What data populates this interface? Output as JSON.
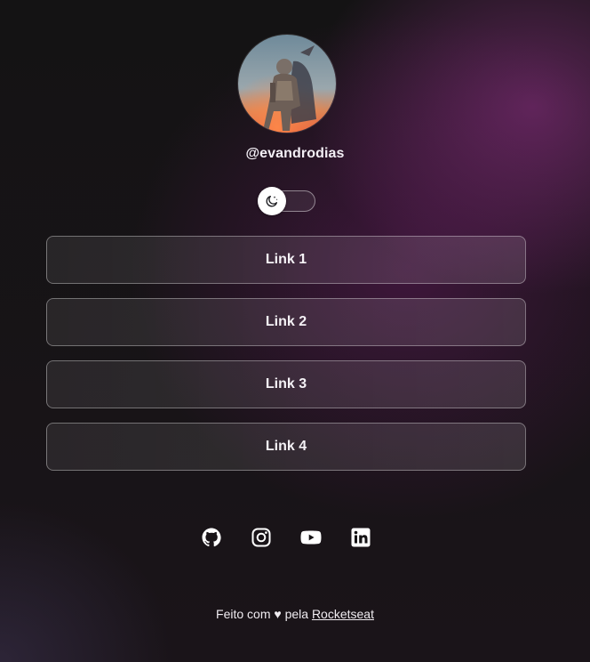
{
  "profile": {
    "avatar_alt": "",
    "handle": "@evandrodias"
  },
  "theme_switch": {
    "state": "dark",
    "icon": "moon-icon"
  },
  "links": [
    {
      "label": "Link 1"
    },
    {
      "label": "Link 2"
    },
    {
      "label": "Link 3"
    },
    {
      "label": "Link 4"
    }
  ],
  "socials": [
    {
      "name": "github",
      "icon": "github-icon"
    },
    {
      "name": "instagram",
      "icon": "instagram-icon"
    },
    {
      "name": "youtube",
      "icon": "youtube-icon"
    },
    {
      "name": "linkedin",
      "icon": "linkedin-icon"
    }
  ],
  "footer": {
    "prefix": "Feito com",
    "heart": "♥",
    "middle": "pela",
    "link": "Rocketseat"
  },
  "colors": {
    "text": "#ffffff",
    "accent": "#8a2f86",
    "background": "#151315"
  }
}
